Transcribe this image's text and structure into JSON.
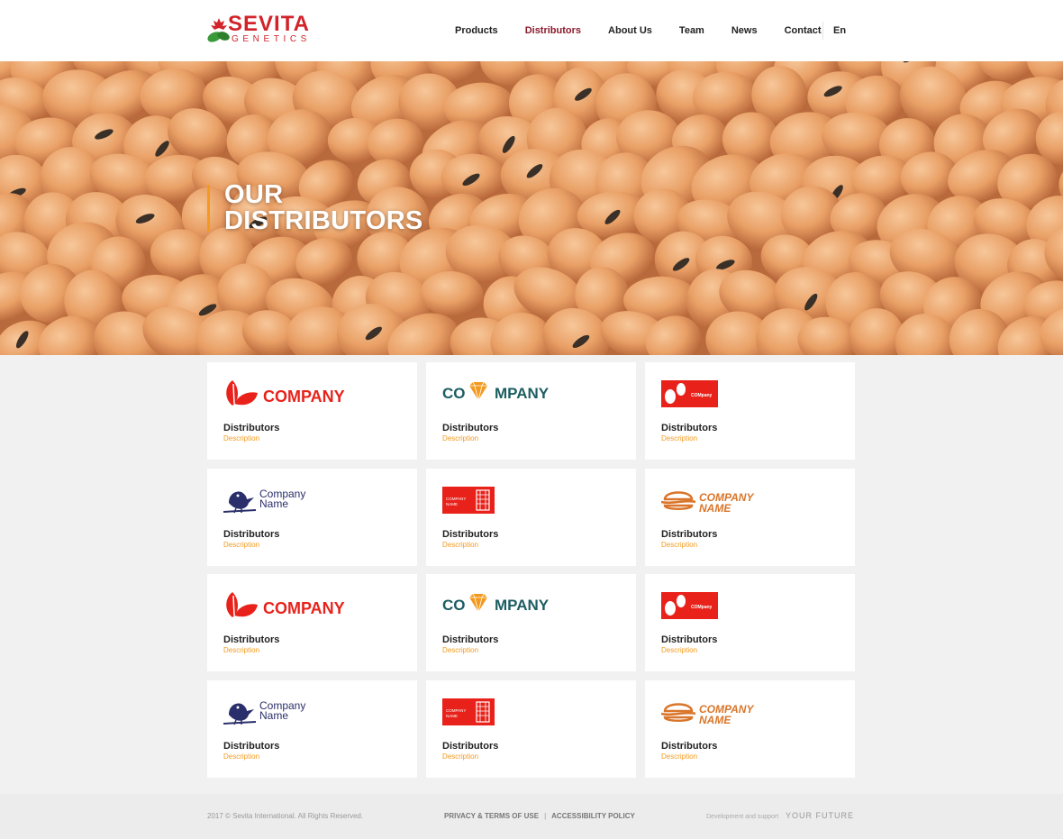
{
  "brand": {
    "name_top": "SEVITA",
    "name_bottom": "GENETICS",
    "accent": "#d2232a"
  },
  "nav": {
    "items": [
      {
        "label": "Products"
      },
      {
        "label": "Distributors",
        "active": true
      },
      {
        "label": "About Us"
      },
      {
        "label": "Team"
      },
      {
        "label": "News"
      },
      {
        "label": "Contact"
      }
    ],
    "lang": "En"
  },
  "hero": {
    "title_line1": "OUR",
    "title_line2": "DISTRIBUTORS",
    "bar_color": "#f39a1e"
  },
  "cards": [
    {
      "logo": "leaf-company-logo",
      "logo_text": "COMPANY",
      "title": "Distributors",
      "desc": "Description"
    },
    {
      "logo": "diamond-company-logo",
      "logo_text_a": "CO",
      "logo_text_b": "MPANY",
      "title": "Distributors",
      "desc": "Description"
    },
    {
      "logo": "eggs-company-logo",
      "logo_text": "COMpany",
      "title": "Distributors",
      "desc": "Description"
    },
    {
      "logo": "bird-company-logo",
      "logo_text_a": "Company",
      "logo_text_b": "Name",
      "title": "Distributors",
      "desc": "Description"
    },
    {
      "logo": "building-company-logo",
      "logo_text_a": "COMPANY",
      "logo_text_b": "NAME",
      "title": "Distributors",
      "desc": "Description"
    },
    {
      "logo": "burger-company-logo",
      "logo_text_a": "COMPANY",
      "logo_text_b": "NAME",
      "title": "Distributors",
      "desc": "Description"
    },
    {
      "logo": "leaf-company-logo",
      "logo_text": "COMPANY",
      "title": "Distributors",
      "desc": "Description"
    },
    {
      "logo": "diamond-company-logo",
      "logo_text_a": "CO",
      "logo_text_b": "MPANY",
      "title": "Distributors",
      "desc": "Description"
    },
    {
      "logo": "eggs-company-logo",
      "logo_text": "COMpany",
      "title": "Distributors",
      "desc": "Description"
    },
    {
      "logo": "bird-company-logo",
      "logo_text_a": "Company",
      "logo_text_b": "Name",
      "title": "Distributors",
      "desc": "Description"
    },
    {
      "logo": "building-company-logo",
      "logo_text_a": "COMPANY",
      "logo_text_b": "NAME",
      "title": "Distributors",
      "desc": "Description"
    },
    {
      "logo": "burger-company-logo",
      "logo_text_a": "COMPANY",
      "logo_text_b": "NAME",
      "title": "Distributors",
      "desc": "Description"
    }
  ],
  "footer": {
    "copyright": "2017 © Sevita International. All Rights Reserved.",
    "privacy": "PRIVACY & TERMS OF USE",
    "separator": "|",
    "accessibility": "ACCESSIBILITY POLICY",
    "dev_text": "Development and support",
    "dev_brand": "YOUR FUTURE"
  },
  "colors": {
    "red": "#e8221b",
    "teal": "#1d5d63",
    "orange": "#f39a1e",
    "navy": "#2a2f6b",
    "burger": "#d9762b",
    "active_nav": "#8b1a2b"
  }
}
